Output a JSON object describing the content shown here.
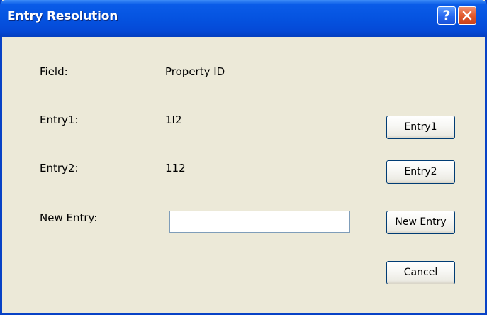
{
  "window": {
    "title": "Entry Resolution",
    "help_glyph": "?"
  },
  "field": {
    "label": "Field:",
    "value": "Property ID"
  },
  "entry1": {
    "label": "Entry1:",
    "value": "1I2",
    "button_label": "Entry1"
  },
  "entry2": {
    "label": "Entry2:",
    "value": "112",
    "button_label": "Entry2"
  },
  "new_entry": {
    "label": "New Entry:",
    "value": "",
    "button_label": "New Entry"
  },
  "cancel": {
    "button_label": "Cancel"
  },
  "icons": {
    "help": "question-mark-icon",
    "close": "close-x-icon"
  },
  "colors": {
    "titlebar": "#0553e0",
    "window_face": "#ece9d8",
    "close_button": "#e25a2c"
  }
}
